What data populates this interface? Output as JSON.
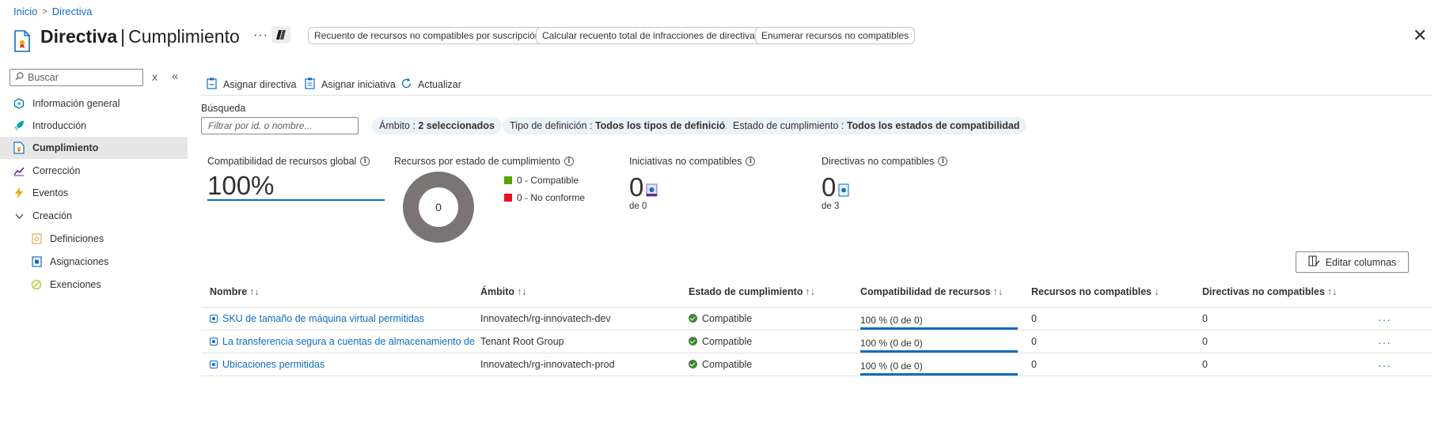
{
  "breadcrumb": {
    "home": "Inicio",
    "current": "Directiva"
  },
  "header": {
    "title_bold": "Directiva",
    "title_sep": "|",
    "title_rest": "Cumplimiento",
    "more": "···",
    "actions": [
      "Recuento de recursos no compatibles por suscripción",
      "Calcular recuento total de infracciones de directiva",
      "Enumerar recursos no compatibles"
    ],
    "close": "✕"
  },
  "sidebar": {
    "search_placeholder": "Buscar",
    "clear": "x",
    "collapse": "«",
    "items": [
      {
        "label": "Información general",
        "icon": "overview-icon"
      },
      {
        "label": "Introducción",
        "icon": "rocket-icon"
      },
      {
        "label": "Cumplimiento",
        "icon": "compliance-icon",
        "active": true
      },
      {
        "label": "Corrección",
        "icon": "remediation-icon"
      },
      {
        "label": "Eventos",
        "icon": "lightning-icon"
      },
      {
        "label": "Creación",
        "icon": "chevron-down-icon",
        "expanded": true
      },
      {
        "label": "Definiciones",
        "icon": "definitions-icon"
      },
      {
        "label": "Asignaciones",
        "icon": "assignments-icon"
      },
      {
        "label": "Exenciones",
        "icon": "exemptions-icon"
      }
    ]
  },
  "toolbar": {
    "assign_policy": "Asignar directiva",
    "assign_initiative": "Asignar iniciativa",
    "refresh": "Actualizar"
  },
  "filters": {
    "search_label": "Búsqueda",
    "search_placeholder": "Filtrar por id. o nombre...",
    "scope_label": "Ámbito : ",
    "scope_value": "2 seleccionados",
    "type_label": "Tipo de definición : ",
    "type_value": "Todos los tipos de definición",
    "state_label": "Estado de cumplimiento : ",
    "state_value": "Todos los estados de compatibilidad"
  },
  "summary": {
    "overall_title": "Compatibilidad de recursos global",
    "overall_value": "100%",
    "by_state_title": "Recursos por estado de cumplimiento",
    "donut_center": "0",
    "legend": [
      {
        "label": "0 - Compatible",
        "color": "#57a300"
      },
      {
        "label": "0 - No conforme",
        "color": "#e81123"
      }
    ],
    "initiatives_title": "Iniciativas no compatibles",
    "initiatives_value": "0",
    "initiatives_of": "de 0",
    "policies_title": "Directivas no compatibles",
    "policies_value": "0",
    "policies_of": "de 3"
  },
  "table": {
    "edit_columns": "Editar columnas",
    "headers": [
      {
        "label": "Nombre",
        "sort": "↑↓"
      },
      {
        "label": "Ámbito",
        "sort": "↑↓"
      },
      {
        "label": "Estado de cumplimiento",
        "sort": "↑↓"
      },
      {
        "label": "Compatibilidad de recursos",
        "sort": "↑↓"
      },
      {
        "label": "Recursos no compatibles",
        "sort": "↓"
      },
      {
        "label": "Directivas no compatibles",
        "sort": "↑↓"
      }
    ],
    "rows": [
      {
        "name": "SKU de tamaño de máquina virtual permitidas",
        "scope": "Innovatech/rg-innovatech-dev",
        "state": "Compatible",
        "compliance": "100 % (0 de 0)",
        "compliance_fraction": 1.0,
        "noncompliant_resources": "0",
        "noncompliant_policies": "0",
        "more": "···"
      },
      {
        "name": "La transferencia segura a cuentas de almacenamiento debe estar habilitada",
        "scope": "Tenant Root Group",
        "state": "Compatible",
        "compliance": "100 % (0 de 0)",
        "compliance_fraction": 1.0,
        "noncompliant_resources": "0",
        "noncompliant_policies": "0",
        "more": "···"
      },
      {
        "name": "Ubicaciones permitidas",
        "scope": "Innovatech/rg-innovatech-prod",
        "state": "Compatible",
        "compliance": "100 % (0 de 0)",
        "compliance_fraction": 1.0,
        "noncompliant_resources": "0",
        "noncompliant_policies": "0",
        "more": "···"
      }
    ]
  }
}
